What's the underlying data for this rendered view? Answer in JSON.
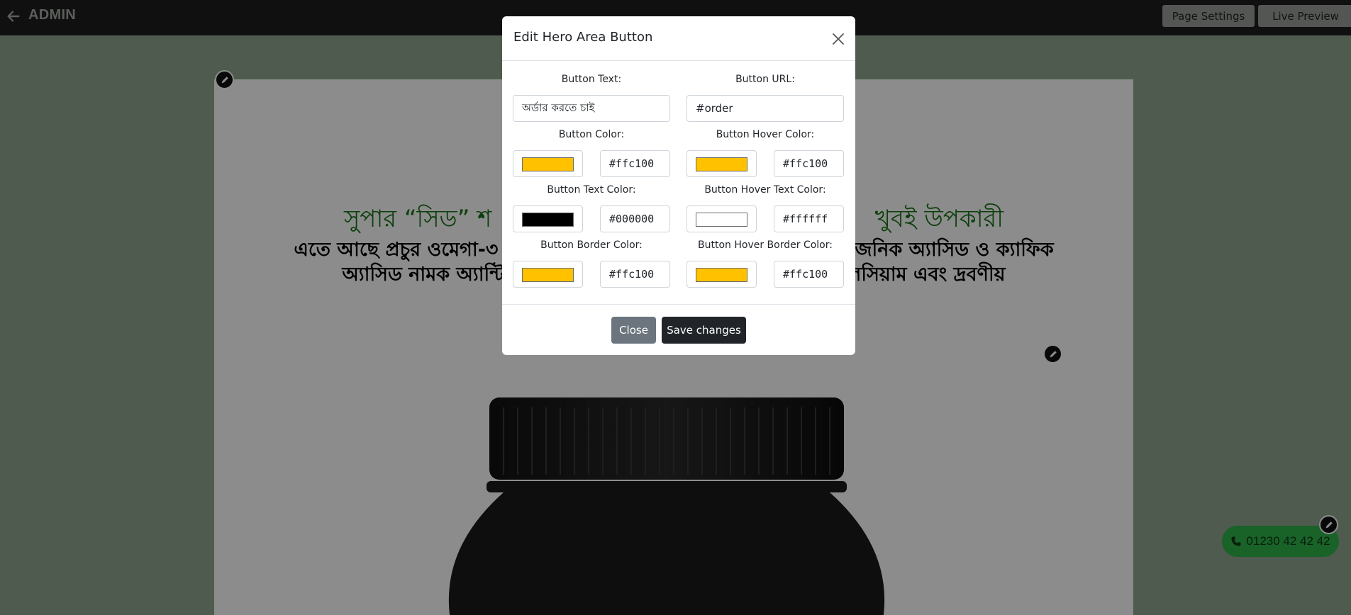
{
  "topbar": {
    "brand": "ADMIN",
    "back_icon": "arrow-left-icon",
    "page_settings_label": "Page Settings",
    "live_preview_label": "Live Preview"
  },
  "page": {
    "headline": "সুপার “সিড” শ                                                  খুবই উপকারী",
    "subtext_line1": "এতে আছে প্রচুর ওমেগা-৩ ফ্যা                                            রোজেনিক অ্যাসিড ও ক্যাফিক",
    "subtext_line2": "অ্যাসিড নামক অ্যান্টি-অ                                            ক্যালসিয়াম এবং দ্রবণীয়",
    "phone": "01230 42 42 42",
    "phone_icon": "phone-icon",
    "edit_icon": "pen-edit-icon"
  },
  "modal": {
    "title": "Edit Hero Area Button",
    "close_icon": "close-icon",
    "button_text_label": "Button Text:",
    "button_text_value": "অর্ডার করতে চাই",
    "button_url_label": "Button URL:",
    "button_url_value": "#order",
    "button_color_label": "Button Color:",
    "button_color_value": "#ffc100",
    "button_hover_color_label": "Button Hover Color:",
    "button_hover_color_value": "#ffc100",
    "button_text_color_label": "Button Text Color:",
    "button_text_color_value": "#000000",
    "button_hover_text_color_label": "Button Hover Text Color:",
    "button_hover_text_color_value": "#ffffff",
    "button_border_color_label": "Button Border Color:",
    "button_border_color_value": "#ffc100",
    "button_hover_border_color_label": "Button Hover Border Color:",
    "button_hover_border_color_value": "#ffc100",
    "close_label": "Close",
    "save_label": "Save changes"
  },
  "colors": {
    "accent_yellow": "#ffc100",
    "page_bg": "#8fa68f",
    "topbar_bg": "#1c1e1c",
    "headline_green": "#177317"
  }
}
